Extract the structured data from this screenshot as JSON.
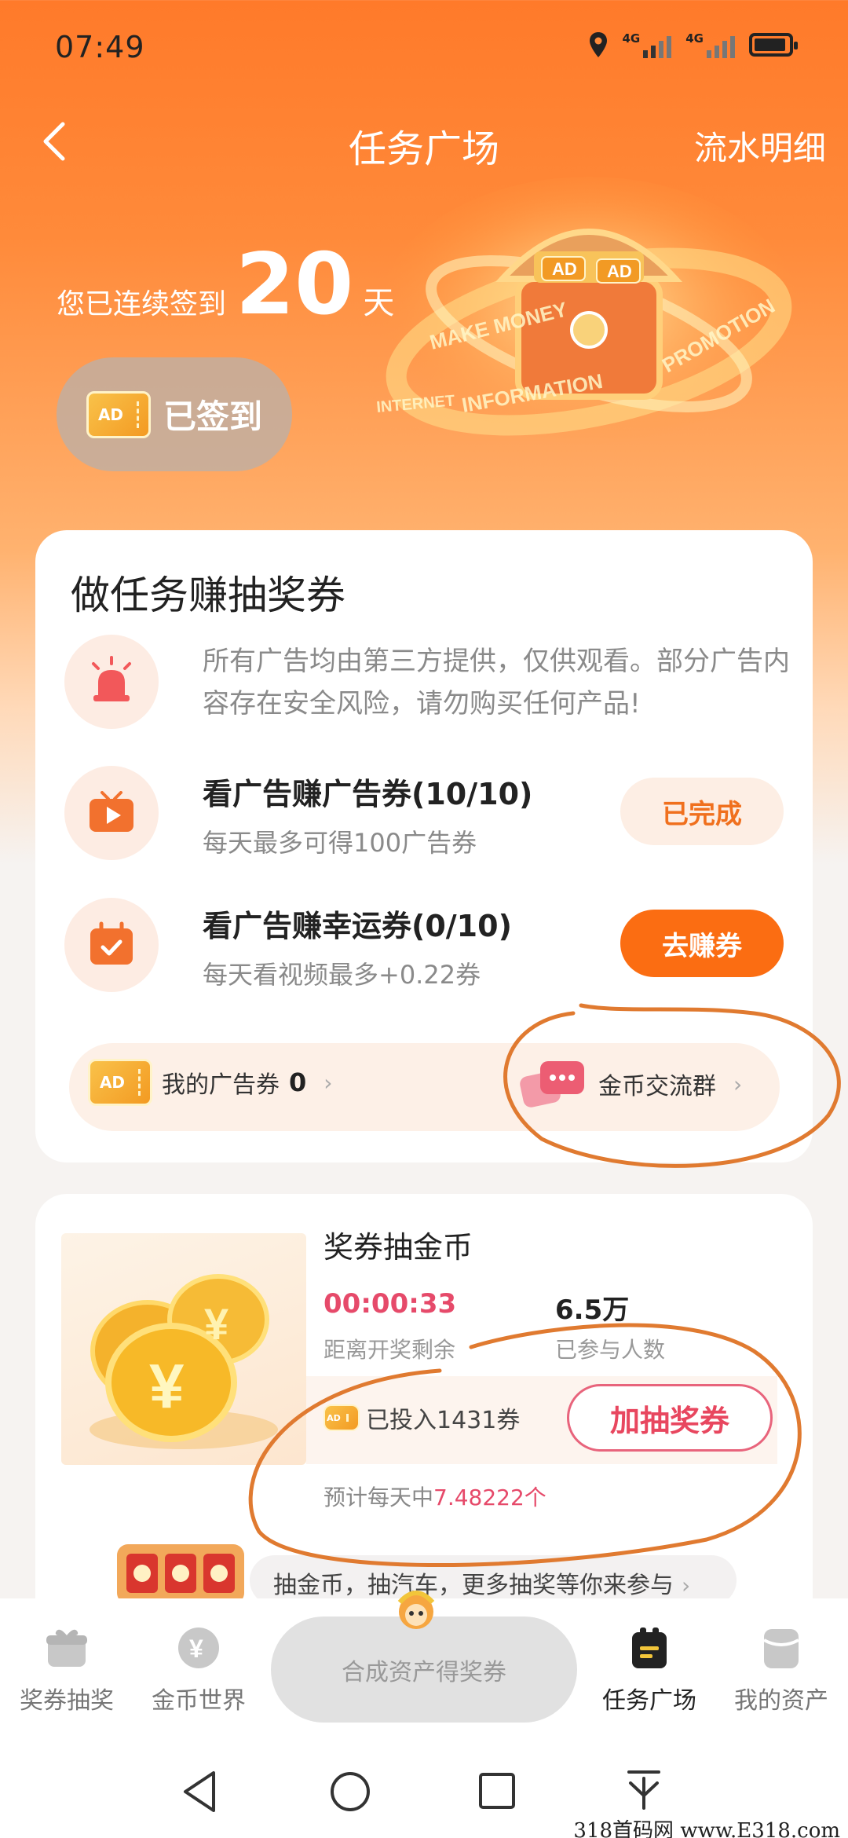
{
  "status_bar": {
    "time": "07:49",
    "signal1_label": "4G",
    "signal2_label": "4G",
    "icons": [
      "location-icon",
      "signal-icon",
      "signal-icon",
      "battery-icon"
    ]
  },
  "header": {
    "title": "任务广场",
    "detail_link": "流水明细",
    "back_icon": "chevron-left-icon"
  },
  "signin": {
    "prefix": "您已连续签到",
    "days": "20",
    "suffix": "天",
    "button_label": "已签到",
    "ticket_text": "AD"
  },
  "chest_art": {
    "ticket_text": "AD",
    "ring_words": [
      "MAKE MONEY",
      "INFORMATION",
      "PROMOTION",
      "INTERNET"
    ]
  },
  "task_card": {
    "title": "做任务赚抽奖券",
    "notice": "所有广告均由第三方提供，仅供观看。部分广告内容存在安全风险，请勿购买任何产品!",
    "tasks": [
      {
        "title": "看广告赚广告券(10/10)",
        "sub": "每天最多可得100广告券",
        "button": "已完成",
        "icon": "play-video-icon"
      },
      {
        "title": "看广告赚幸运券(0/10)",
        "sub": "每天看视频最多+0.22券",
        "button": "去赚券",
        "icon": "calendar-check-icon"
      }
    ],
    "my_tickets_label": "我的广告券",
    "my_tickets_count": "0",
    "group_label": "金币交流群",
    "ticket_text": "AD"
  },
  "lottery_card": {
    "title": "奖券抽金币",
    "countdown": "00:00:33",
    "countdown_label": "距离开奖剩余",
    "participants": "6.5万",
    "participants_label": "已参与人数",
    "invested_label": "已投入1431券",
    "add_button": "加抽奖券",
    "expect_prefix": "预计每天中",
    "expect_value": "7.48222个",
    "promo_text": "抽金币，抽汽车，更多抽奖等你来参与",
    "coin_symbol": "¥",
    "ticket_text": "AD"
  },
  "bottom_nav": {
    "items": [
      {
        "label": "奖券抽奖",
        "icon": "gift-icon"
      },
      {
        "label": "金币世界",
        "icon": "yuan-coin-icon"
      },
      {
        "label": "任务广场",
        "icon": "clipboard-icon"
      },
      {
        "label": "我的资产",
        "icon": "wallet-icon"
      }
    ],
    "center_label": "合成资产得奖券",
    "active": "任务广场"
  },
  "system_nav": [
    "back-triangle-icon",
    "home-circle-icon",
    "recents-square-icon",
    "download-icon"
  ],
  "watermark": "318首码网  www.E318.com",
  "colors": {
    "accent": "#fb6d12",
    "pink": "#e8475f",
    "annotation": "#e07a30"
  }
}
